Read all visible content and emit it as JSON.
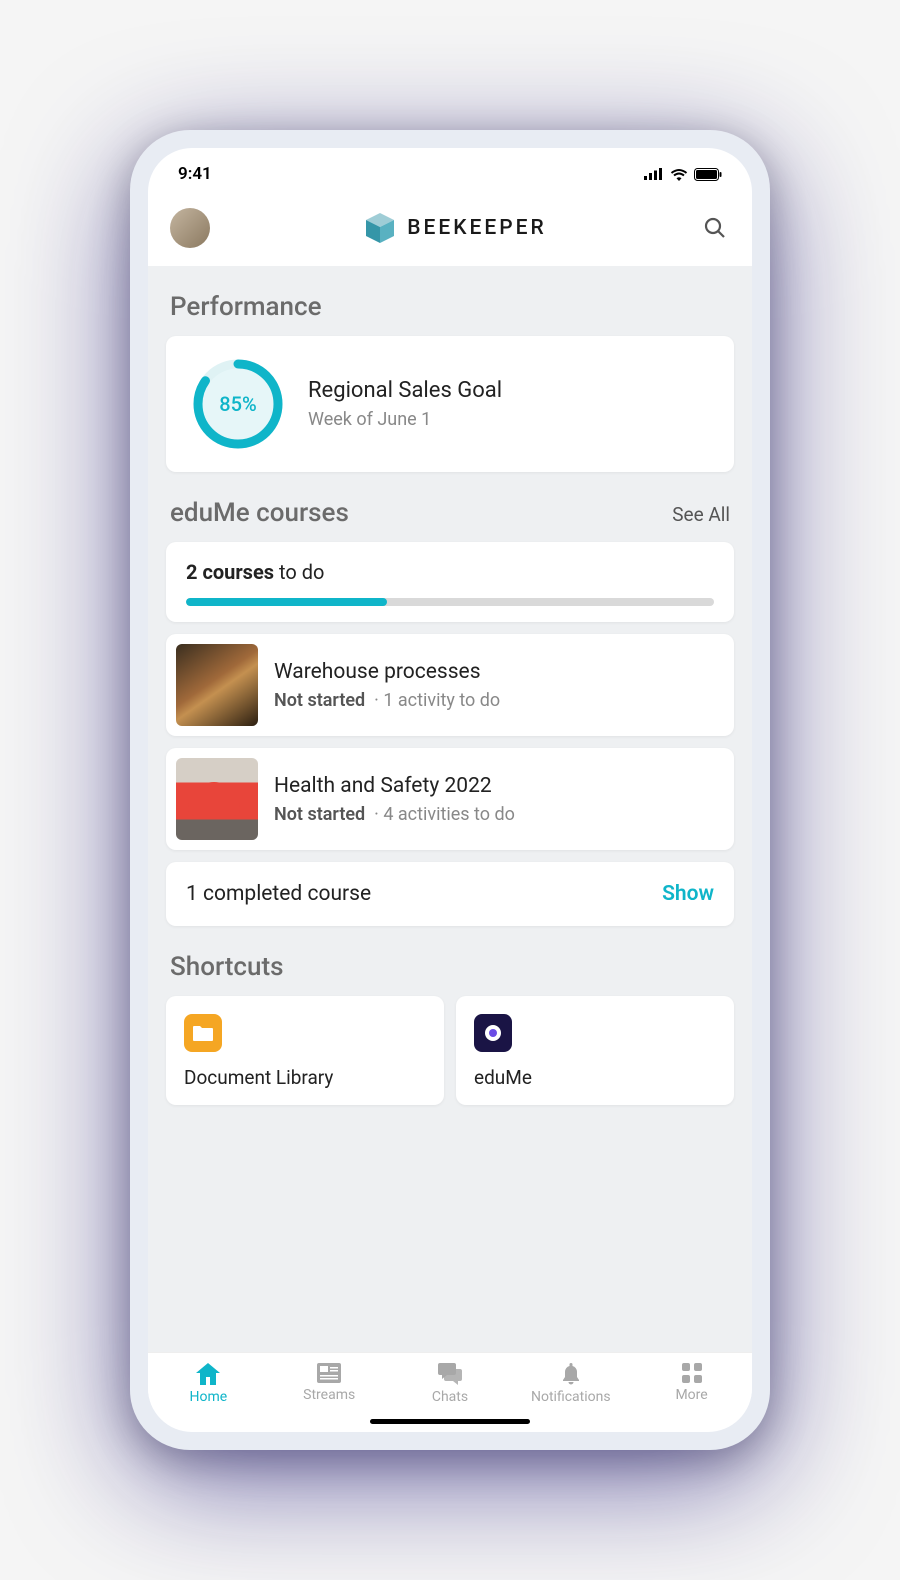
{
  "status": {
    "time": "9:41"
  },
  "header": {
    "brand": "BEEKEEPER"
  },
  "performance": {
    "title": "Performance",
    "percent": "85%",
    "percent_value": 85,
    "goal_title": "Regional Sales Goal",
    "goal_sub": "Week of June 1"
  },
  "courses": {
    "title": "eduMe courses",
    "see_all": "See All",
    "count_bold": "2 courses",
    "count_rest": " to do",
    "progress_percent": 38,
    "items": [
      {
        "name": "Warehouse processes",
        "status": "Not started",
        "meta": "1 activity to do"
      },
      {
        "name": "Health and Safety 2022",
        "status": "Not started",
        "meta": "4 activities to do"
      }
    ],
    "completed_text": "1 completed course",
    "show_label": "Show"
  },
  "shortcuts": {
    "title": "Shortcuts",
    "items": [
      {
        "label": "Document Library",
        "icon": "folder"
      },
      {
        "label": "eduMe",
        "icon": "edume"
      }
    ]
  },
  "nav": {
    "items": [
      {
        "label": "Home",
        "active": true
      },
      {
        "label": "Streams",
        "active": false
      },
      {
        "label": "Chats",
        "active": false
      },
      {
        "label": "Notifications",
        "active": false
      },
      {
        "label": "More",
        "active": false
      }
    ]
  }
}
